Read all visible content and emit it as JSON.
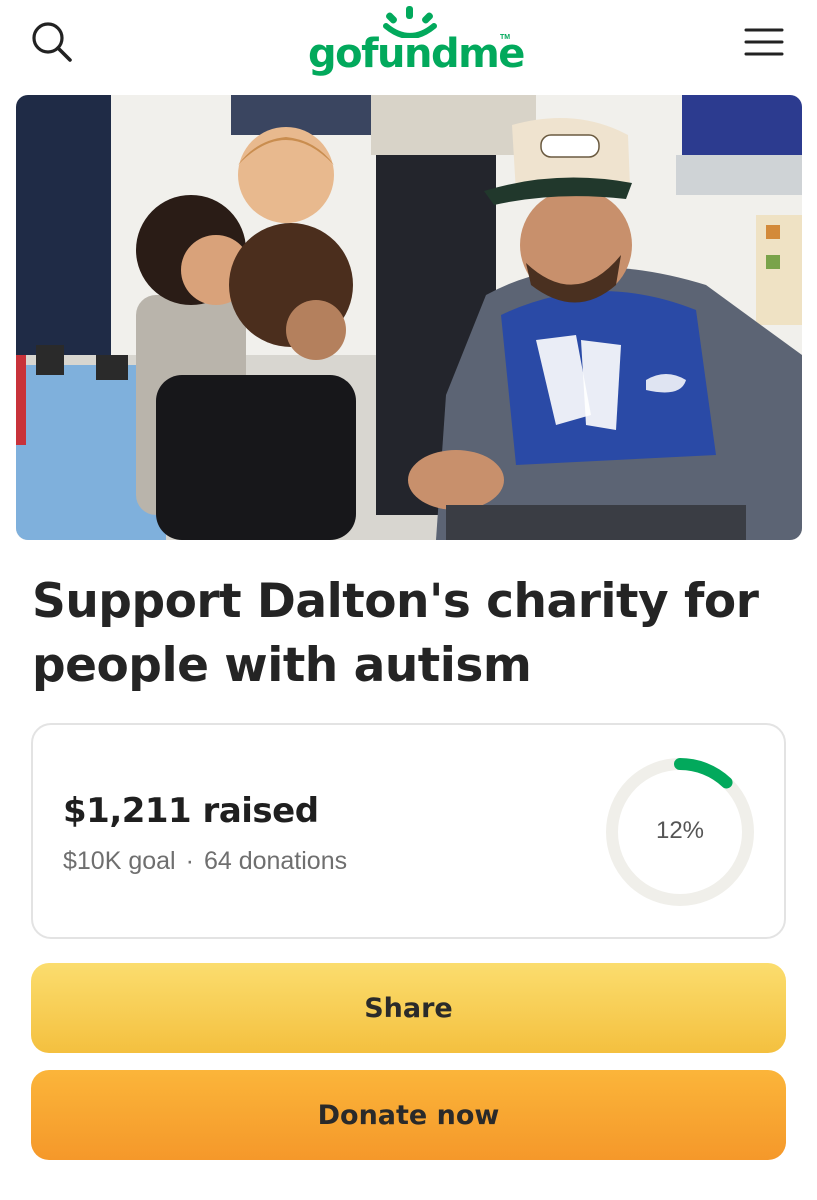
{
  "header": {
    "logo_text": "gofundme",
    "logo_tm": "TM",
    "search_icon": "search-icon",
    "menu_icon": "hamburger-menu-icon"
  },
  "hero": {
    "image_subject": "campaign-photo"
  },
  "campaign": {
    "title": "Support Dalton's charity for people with autism"
  },
  "progress": {
    "raised_amount": "$1,211",
    "raised_label": "raised",
    "goal": "$10K goal",
    "separator": "·",
    "donations": "64 donations",
    "percent_label": "12%",
    "percent": 12
  },
  "actions": {
    "share_label": "Share",
    "donate_label": "Donate now"
  },
  "colors": {
    "brand_green": "#02a95c",
    "share_yellow": "#f7cc4f",
    "donate_orange": "#f8a531",
    "ring_track": "#f0efea"
  }
}
